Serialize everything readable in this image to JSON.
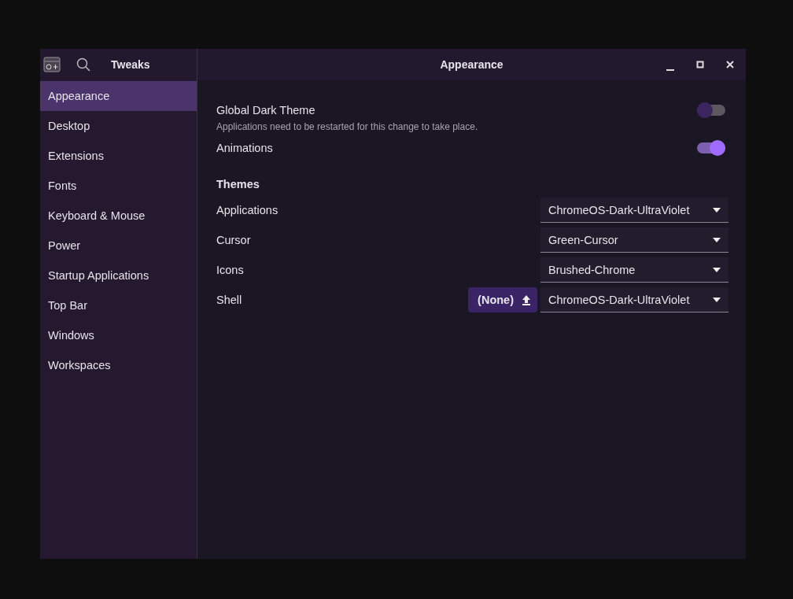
{
  "app_title": "Tweaks",
  "window": {
    "title": "Appearance"
  },
  "sidebar": {
    "items": [
      {
        "label": "Appearance",
        "selected": true
      },
      {
        "label": "Desktop",
        "selected": false
      },
      {
        "label": "Extensions",
        "selected": false
      },
      {
        "label": "Fonts",
        "selected": false
      },
      {
        "label": "Keyboard & Mouse",
        "selected": false
      },
      {
        "label": "Power",
        "selected": false
      },
      {
        "label": "Startup Applications",
        "selected": false
      },
      {
        "label": "Top Bar",
        "selected": false
      },
      {
        "label": "Windows",
        "selected": false
      },
      {
        "label": "Workspaces",
        "selected": false
      }
    ]
  },
  "switches": [
    {
      "label": "Global Dark Theme",
      "description": "Applications need to be restarted for this change to take place.",
      "on": false
    },
    {
      "label": "Animations",
      "on": true
    }
  ],
  "themes": {
    "heading": "Themes",
    "rows": [
      {
        "label": "Applications",
        "value": "ChromeOS-Dark-UltraViolet"
      },
      {
        "label": "Cursor",
        "value": "Green-Cursor"
      },
      {
        "label": "Icons",
        "value": "Brushed-Chrome"
      },
      {
        "label": "Shell",
        "value": "ChromeOS-Dark-UltraViolet",
        "button": "(None)"
      }
    ]
  }
}
